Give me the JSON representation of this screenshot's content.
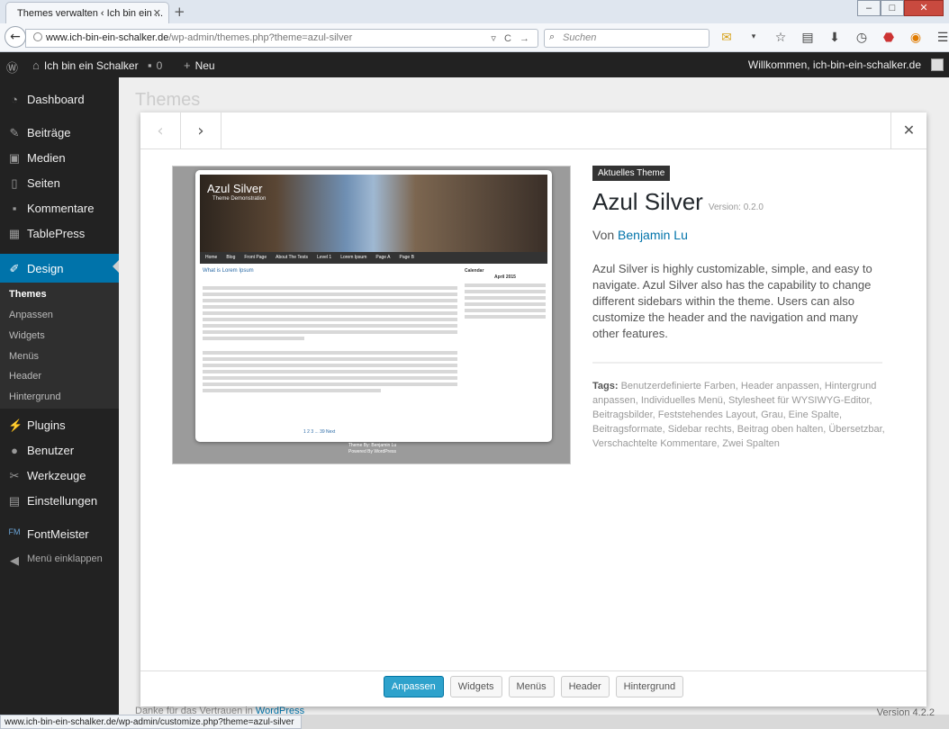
{
  "browser": {
    "tab_title": "Themes verwalten ‹ Ich bin ein ...",
    "url_domain": "www.ich-bin-ein-schalker.de",
    "url_path": "/wp-admin/themes.php?theme=azul-silver",
    "search_placeholder": "Suchen",
    "status_url": "www.ich-bin-ein-schalker.de/wp-admin/customize.php?theme=azul-silver"
  },
  "adminbar": {
    "site_name": "Ich bin ein Schalker",
    "comments_count": "0",
    "new_label": "Neu",
    "greeting": "Willkommen, ich-bin-ein-schalker.de"
  },
  "sidebar": {
    "items": [
      {
        "label": "Dashboard",
        "icon": "dashboard-icon"
      },
      {
        "label": "Beiträge",
        "icon": "pin-icon"
      },
      {
        "label": "Medien",
        "icon": "media-icon"
      },
      {
        "label": "Seiten",
        "icon": "page-icon"
      },
      {
        "label": "Kommentare",
        "icon": "comment-icon"
      },
      {
        "label": "TablePress",
        "icon": "table-icon"
      },
      {
        "label": "Design",
        "icon": "brush-icon"
      },
      {
        "label": "Plugins",
        "icon": "plugin-icon"
      },
      {
        "label": "Benutzer",
        "icon": "user-icon"
      },
      {
        "label": "Werkzeuge",
        "icon": "wrench-icon"
      },
      {
        "label": "Einstellungen",
        "icon": "settings-icon"
      },
      {
        "label": "FontMeister",
        "icon": "fm-icon"
      }
    ],
    "submenu": [
      "Themes",
      "Anpassen",
      "Widgets",
      "Menüs",
      "Header",
      "Hintergrund"
    ],
    "collapse_label": "Menü einklappen"
  },
  "background": {
    "page_title": "Themes",
    "footer_prefix": "Danke für das Vertrauen in ",
    "footer_link": "WordPress",
    "version": "Version 4.2.2"
  },
  "theme": {
    "badge": "Aktuelles Theme",
    "name": "Azul Silver",
    "version": "Version: 0.2.0",
    "author_prefix": "Von ",
    "author": "Benjamin Lu",
    "description": "Azul Silver is highly customizable, simple, and easy to navigate. Azul Silver also has the capability to change different sidebars within the theme. Users can also customize the header and the navigation and many other features.",
    "tags_label": "Tags:",
    "tags": "Benutzerdefinierte Farben, Header anpassen, Hintergrund anpassen, Individuelles Menü, Stylesheet für WYSIWYG-Editor, Beitragsbilder, Feststehendes Layout, Grau, Eine Spalte, Beitragsformate, Sidebar rechts, Beitrag oben halten, Übersetzbar, Verschachtelte Kommentare, Zwei Spalten"
  },
  "footer_buttons": {
    "customize": "Anpassen",
    "widgets": "Widgets",
    "menus": "Menüs",
    "header": "Header",
    "background": "Hintergrund"
  },
  "preview": {
    "title": "Azul Silver",
    "subtitle": "Theme Demonstration",
    "nav": [
      "Home",
      "Blog",
      "Front Page",
      "About The Tests",
      "Level 1",
      "Lorem Ipsum",
      "Page A",
      "Page B"
    ],
    "post_title": "What is Lorem Ipsum",
    "calendar_title": "Calendar",
    "calendar_month": "April 2015",
    "pagination": "1  2  3  ...  39  Next",
    "footer_line1": "Theme By: Benjamin Lu",
    "footer_line2": "Powered By WordPress"
  }
}
